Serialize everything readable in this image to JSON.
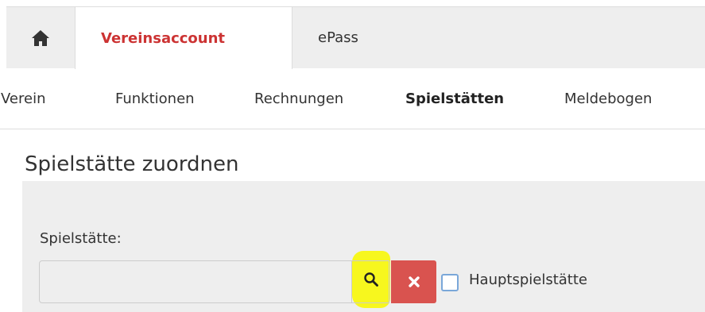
{
  "tabs": {
    "home_icon": "home-icon",
    "active": "Vereinsaccount",
    "secondary": "ePass"
  },
  "subnav": {
    "items": [
      "Verein",
      "Funktionen",
      "Rechnungen",
      "Spielstätten",
      "Meldebogen"
    ],
    "active": "Spielstätten"
  },
  "section": {
    "title": "Spielstätte zuordnen"
  },
  "form": {
    "label": "Spielstätte:",
    "input_value": "",
    "search_icon": "search-icon",
    "clear_icon": "close-icon",
    "checkbox_label": "Hauptspielstätte",
    "checkbox_checked": false
  },
  "colors": {
    "active_tab_text": "#cc3333",
    "clear_button": "#d9534f",
    "highlight": "#f7f71e",
    "panel_background": "#eeeeee"
  }
}
